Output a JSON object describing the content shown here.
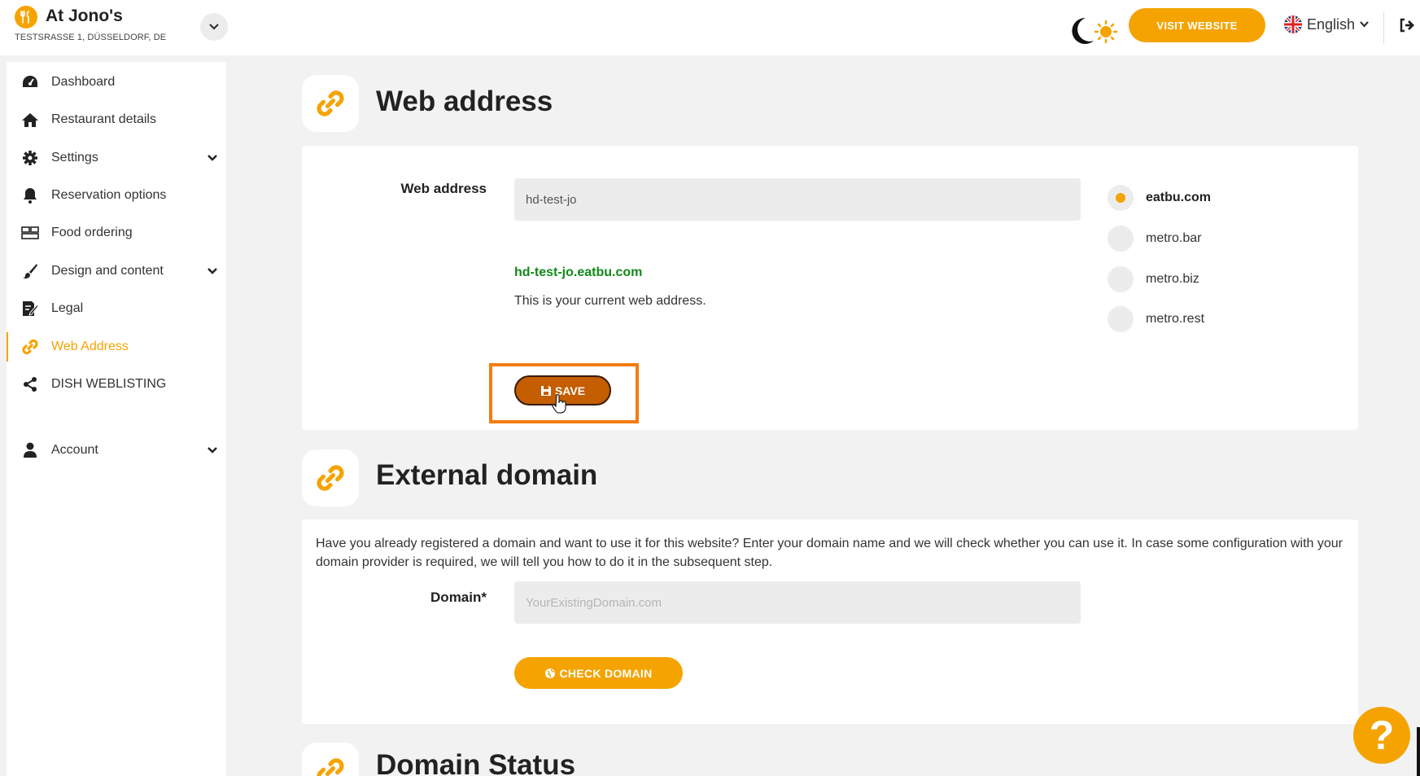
{
  "topbar": {
    "restaurant_name": "At Jono's",
    "restaurant_address": "TESTSRASSE 1, DÜSSELDORF, DE",
    "visit_website_label": "VISIT WEBSITE",
    "language_label": "English"
  },
  "sidebar": {
    "items": [
      {
        "label": "Dashboard",
        "icon": "dashboard-icon"
      },
      {
        "label": "Restaurant details",
        "icon": "home-icon"
      },
      {
        "label": "Settings",
        "icon": "gear-icon",
        "expandable": true
      },
      {
        "label": "Reservation options",
        "icon": "bell-icon"
      },
      {
        "label": "Food ordering",
        "icon": "food-ordering-icon"
      },
      {
        "label": "Design and content",
        "icon": "brush-icon",
        "expandable": true
      },
      {
        "label": "Legal",
        "icon": "legal-icon"
      },
      {
        "label": "Web Address",
        "icon": "link-icon",
        "active": true
      },
      {
        "label": "DISH WEBLISTING",
        "icon": "share-icon"
      },
      {
        "label": "Account",
        "icon": "user-icon",
        "expandable": true
      }
    ]
  },
  "web_address": {
    "title": "Web address",
    "field_label": "Web address",
    "field_value": "hd-test-jo",
    "current_url": "hd-test-jo.eatbu.com",
    "helper_text": "This is your current web address.",
    "save_label": "SAVE",
    "domains": [
      {
        "label": "eatbu.com",
        "selected": true
      },
      {
        "label": "metro.bar",
        "selected": false
      },
      {
        "label": "metro.biz",
        "selected": false
      },
      {
        "label": "metro.rest",
        "selected": false
      }
    ]
  },
  "external_domain": {
    "title": "External domain",
    "description": "Have you already registered a domain and want to use it for this website? Enter your domain name and we will check whether you can use it. In case some configuration with your domain provider is required, we will tell you how to do it in the subsequent step.",
    "field_label": "Domain*",
    "placeholder": "YourExistingDomain.com",
    "check_label": "CHECK DOMAIN"
  },
  "domain_status": {
    "title": "Domain Status"
  },
  "help": {
    "label": "?"
  },
  "colors": {
    "accent": "#f5a300",
    "save_button": "#c45e00",
    "highlight": "#f47c10",
    "url_green": "#118a1a"
  }
}
